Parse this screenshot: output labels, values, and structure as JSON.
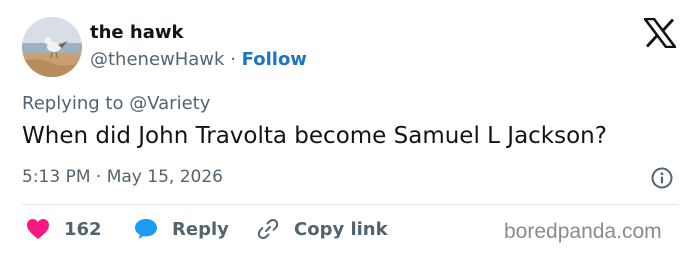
{
  "user": {
    "name": "the hawk",
    "handle": "@thenewHawk",
    "separator": "·",
    "follow_label": "Follow"
  },
  "tweet": {
    "replying_prefix": "Replying to",
    "replying_to": "@Variety",
    "text": "When did John Travolta become Samuel L Jackson?",
    "timestamp": "5:13 PM · May 15, 2026"
  },
  "actions": {
    "like_count": "162",
    "reply_label": "Reply",
    "copy_link_label": "Copy link"
  },
  "icons": {
    "logo": "x-logo-icon",
    "info": "info-icon",
    "like": "heart-icon",
    "reply": "reply-bubble-icon",
    "copy": "link-icon"
  },
  "colors": {
    "like": "#f91880",
    "reply": "#1d9bf0",
    "follow": "#1d74c7",
    "muted": "#536471"
  },
  "watermark": "boredpanda.com"
}
